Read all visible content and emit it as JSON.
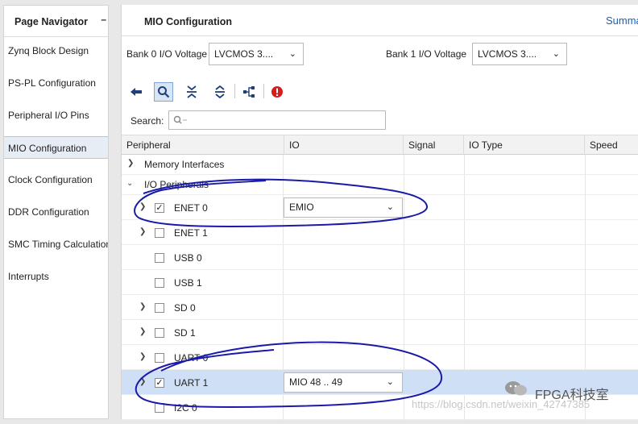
{
  "page_navigator": {
    "title": "Page Navigator",
    "minimize": "–",
    "items": [
      {
        "label": "Zynq Block Design"
      },
      {
        "label": "PS-PL Configuration"
      },
      {
        "label": "Peripheral I/O Pins"
      },
      {
        "label": "MIO Configuration"
      },
      {
        "label": "Clock Configuration"
      },
      {
        "label": "DDR Configuration"
      },
      {
        "label": "SMC Timing Calculation"
      },
      {
        "label": "Interrupts"
      }
    ],
    "selected": "MIO Configuration"
  },
  "main": {
    "title": "MIO Configuration",
    "summary_link": "Summary",
    "bank0": {
      "label": "Bank 0 I/O Voltage",
      "value": "LVCMOS 3...."
    },
    "bank1": {
      "label": "Bank 1 I/O Voltage",
      "value": "LVCMOS 3...."
    }
  },
  "toolbar": {
    "icons": [
      "back-arrow-icon",
      "search-icon",
      "collapse-all-icon",
      "expand-all-icon",
      "hierarchy-icon",
      "error-icon"
    ]
  },
  "search": {
    "label": "Search:",
    "placeholder": "Q-"
  },
  "table": {
    "columns": [
      "Peripheral",
      "IO",
      "Signal",
      "IO Type",
      "Speed"
    ],
    "rows": [
      {
        "label": "Memory Interfaces",
        "type": "group",
        "expanded": false
      },
      {
        "label": "I/O Peripherals",
        "type": "group",
        "expanded": true
      },
      {
        "label": "ENET 0",
        "checked": true,
        "expandable": true,
        "io": "EMIO"
      },
      {
        "label": "ENET 1",
        "checked": false,
        "expandable": true,
        "io": ""
      },
      {
        "label": "USB 0",
        "checked": false,
        "expandable": false,
        "io": ""
      },
      {
        "label": "USB 1",
        "checked": false,
        "expandable": false,
        "io": ""
      },
      {
        "label": "SD 0",
        "checked": false,
        "expandable": true,
        "io": ""
      },
      {
        "label": "SD 1",
        "checked": false,
        "expandable": true,
        "io": ""
      },
      {
        "label": "UART 0",
        "checked": false,
        "expandable": true,
        "io": ""
      },
      {
        "label": "UART 1",
        "checked": true,
        "expandable": true,
        "io": "MIO 48 .. 49",
        "selected": true
      },
      {
        "label": "I2C 0",
        "checked": false,
        "expandable": false,
        "io": ""
      }
    ]
  },
  "watermark": {
    "url": "https://blog.csdn.net/weixin_42747385",
    "brand": "FPGA科技室"
  },
  "colors": {
    "selection": "#cfe0f6",
    "annotation_ink": "#1a1aa8",
    "link": "#1a5fb4",
    "error": "#d11f1f"
  }
}
